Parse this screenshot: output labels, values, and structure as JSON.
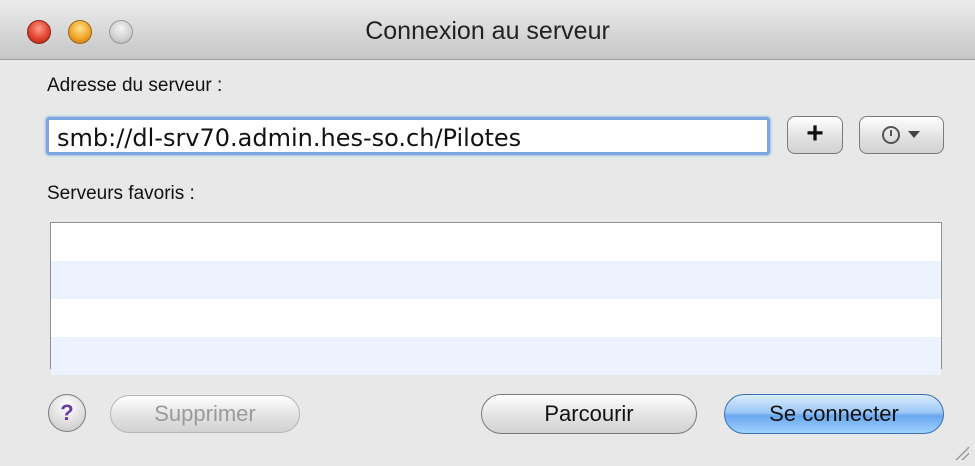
{
  "window": {
    "title": "Connexion au serveur"
  },
  "address": {
    "label": "Adresse du serveur :",
    "value": "smb://dl-srv70.admin.hes-so.ch/Pilotes"
  },
  "buttons": {
    "add_label": "+",
    "delete_label": "Supprimer",
    "browse_label": "Parcourir",
    "connect_label": "Se connecter",
    "help_label": "?"
  },
  "favorites": {
    "label": "Serveurs favoris :",
    "items": []
  },
  "icons": {
    "history": "clock-icon",
    "dropdown": "chevron-down-icon"
  },
  "colors": {
    "focus_ring": "#7aa7e0",
    "default_button": "#6aa7ee",
    "row_alt": "#edf3fe"
  }
}
